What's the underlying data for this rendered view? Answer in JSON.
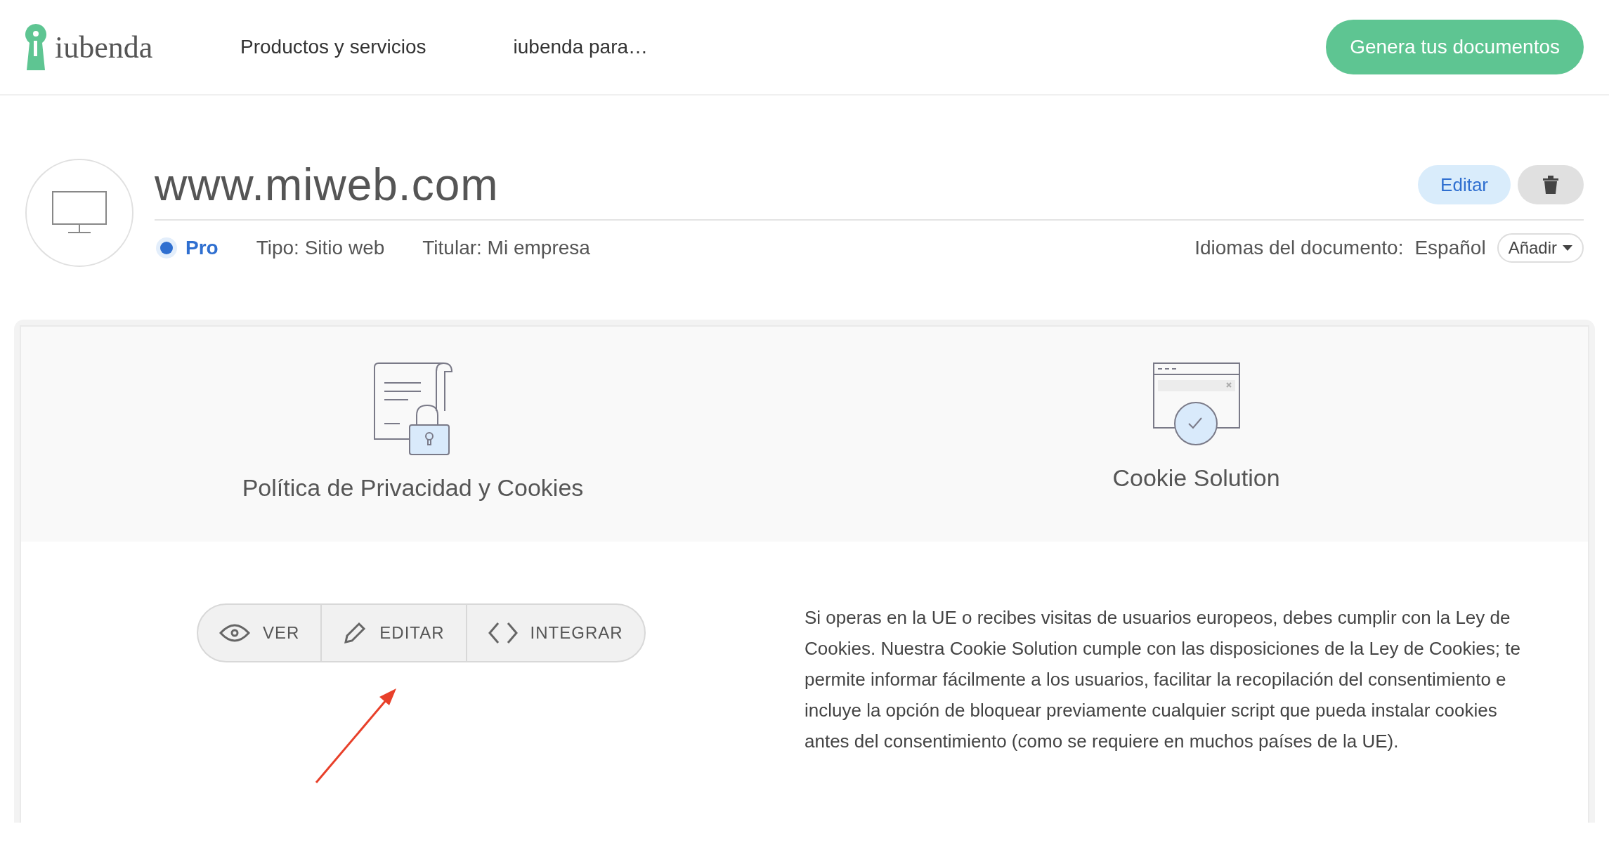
{
  "header": {
    "logo": "iubenda",
    "nav": [
      "Productos y servicios",
      "iubenda para…"
    ],
    "cta": "Genera tus documentos"
  },
  "site": {
    "title": "www.miweb.com",
    "plan": "Pro",
    "type": "Tipo: Sitio web",
    "owner": "Titular: Mi empresa",
    "languages_label": "Idiomas del documento:",
    "language": "Español",
    "add_button": "Añadir",
    "edit_button": "Editar"
  },
  "products": [
    {
      "kind": "privacy",
      "title": "Política de Privacidad y Cookies"
    },
    {
      "kind": "cookie",
      "title": "Cookie Solution"
    }
  ],
  "actions": [
    {
      "kind": "view",
      "label": "VER"
    },
    {
      "kind": "edit",
      "label": "EDITAR"
    },
    {
      "kind": "embed",
      "label": "INTEGRAR"
    }
  ],
  "description": "Si operas en la UE o recibes visitas de usuarios europeos, debes cumplir con la Ley de Cookies. Nuestra Cookie Solution cumple con las disposiciones de la Ley de Cookies; te permite informar fácilmente a los usuarios, facilitar la recopilación del consentimiento e incluye la opción de bloquear previamente cualquier script que pueda instalar cookies antes del consentimiento (como se requiere en muchos países de la UE)."
}
